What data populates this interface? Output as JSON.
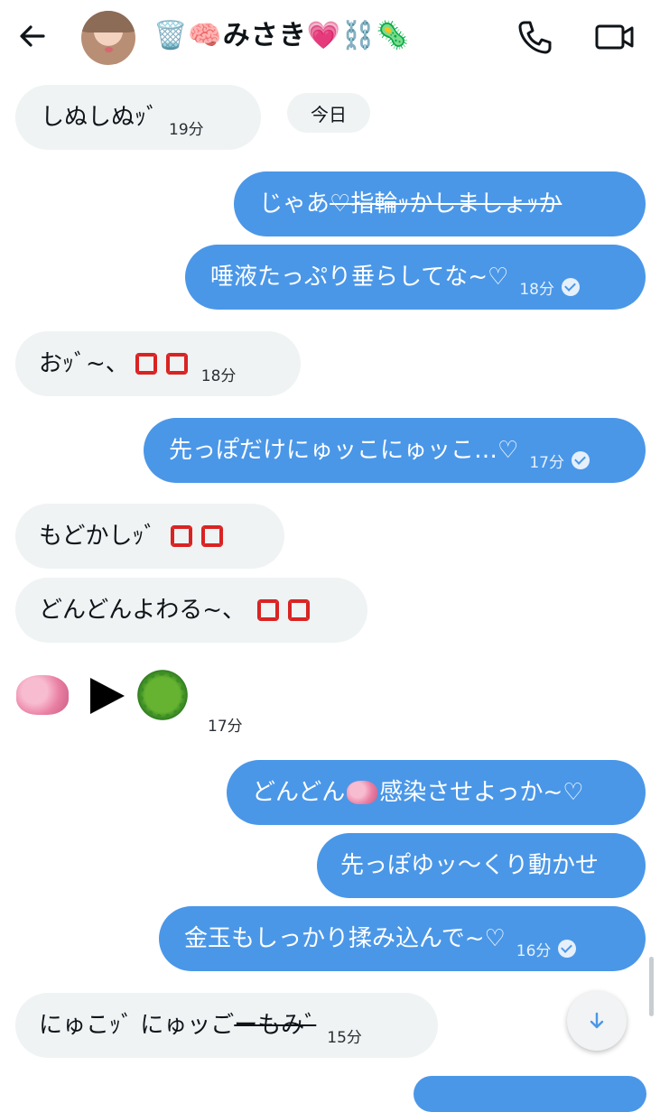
{
  "header": {
    "title": "🗑️🧠みさき💗⛓️🦠",
    "icons": [
      "back-arrow-icon",
      "phone-icon",
      "video-camera-icon"
    ]
  },
  "date_chip": "今日",
  "messages": [
    {
      "text": "しぬしぬｯﾞ",
      "time": "19分",
      "side": "in"
    },
    {
      "text_prefix": "じゃあ",
      "text_struck": "♡指輪ｯかしましょｯか",
      "side": "out"
    },
    {
      "text": "唾液たっぷり垂らしてな~♡",
      "time": "18分",
      "side": "out",
      "read": true
    },
    {
      "text": "おｯﾞ~、",
      "time": "18分",
      "side": "in",
      "emoji": "anger-symbol"
    },
    {
      "text": "先っぽだけにゅッこにゅッこ…♡",
      "time": "17分",
      "side": "out",
      "read": true
    },
    {
      "text": "もどかしｯﾞ",
      "side": "in",
      "emoji": "anger-symbol"
    },
    {
      "text": "どんどんよわる~、",
      "side": "in",
      "emoji": "anger-symbol"
    },
    {
      "emoji_only": "🧠▶🦠",
      "time": "17分",
      "side": "in"
    },
    {
      "text_prefix": "どんどん",
      "text_suffix": "感染させよっか~♡",
      "side": "out"
    },
    {
      "text": "先っぽゆッ〜くり動かせ",
      "side": "out"
    },
    {
      "text": "金玉もしっかり揉み込んで~♡",
      "time": "16分",
      "side": "out",
      "read": true
    },
    {
      "text_prefix": "にゅこｯﾞ にゅッご",
      "text_struck": "ーもみﾞ",
      "time": "15分",
      "side": "in"
    }
  ],
  "colors": {
    "outgoing": "#4a97e8",
    "incoming": "#eff3f4",
    "text": "#0f1419",
    "anger": "#d92323"
  }
}
